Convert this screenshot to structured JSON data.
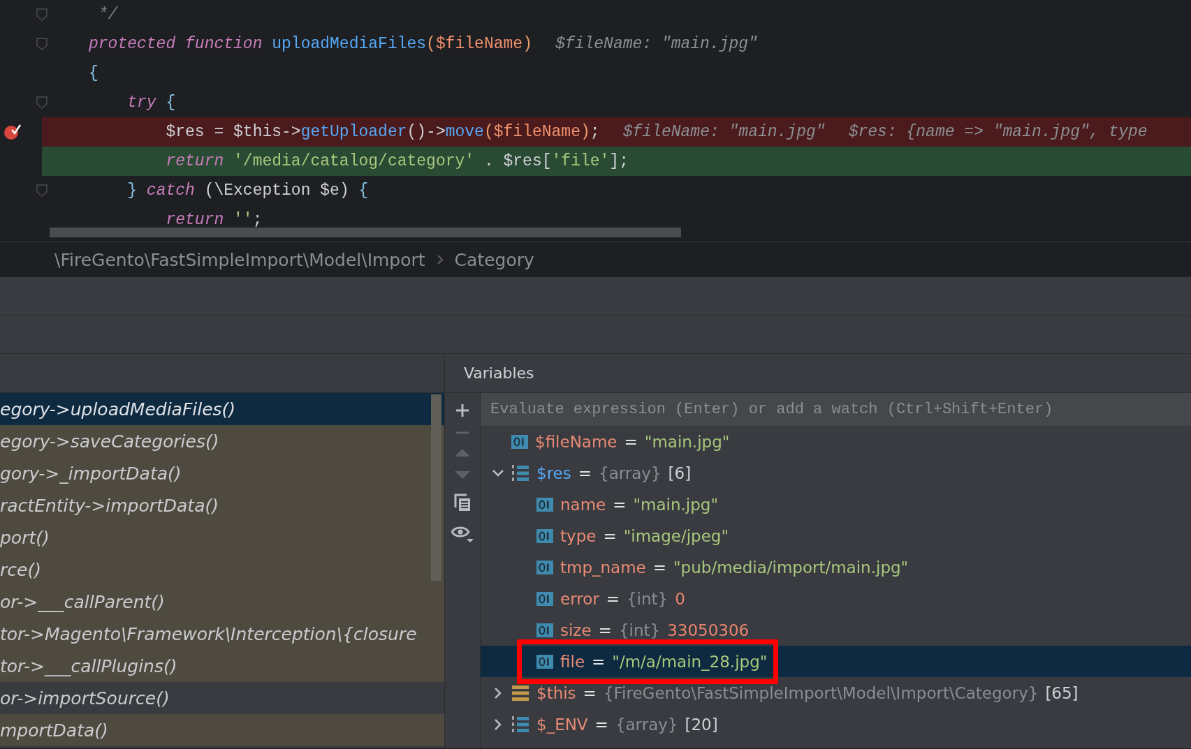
{
  "editor": {
    "lines": [
      {
        "fold": true,
        "breakpoint": false,
        "current": false,
        "tokens": [
          {
            "text": " */",
            "kind": "comment"
          }
        ]
      },
      {
        "fold": true,
        "breakpoint": false,
        "current": false,
        "tokens": [
          {
            "text": "protected function ",
            "kind": "keyword"
          },
          {
            "text": "uploadMediaFiles",
            "kind": "function"
          },
          {
            "text": "(",
            "kind": "paren"
          },
          {
            "text": "$fileName",
            "kind": "variable"
          },
          {
            "text": ")",
            "kind": "paren"
          },
          {
            "text": "$fileName: \"main.jpg\"",
            "kind": "hint"
          }
        ]
      },
      {
        "fold": false,
        "breakpoint": false,
        "current": false,
        "tokens": [
          {
            "text": "{",
            "kind": "brace"
          }
        ]
      },
      {
        "fold": true,
        "breakpoint": false,
        "current": false,
        "tokens": [
          {
            "text": "    try",
            "kind": "keyword"
          },
          {
            "text": " {",
            "kind": "brace"
          }
        ]
      },
      {
        "fold": false,
        "breakpoint": true,
        "current": false,
        "tokens": [
          {
            "text": "        $res = $this->",
            "kind": "plain"
          },
          {
            "text": "getUploader",
            "kind": "function"
          },
          {
            "text": "()->",
            "kind": "plain"
          },
          {
            "text": "move",
            "kind": "function"
          },
          {
            "text": "(",
            "kind": "paren"
          },
          {
            "text": "$fileName",
            "kind": "variable"
          },
          {
            "text": ")",
            "kind": "paren"
          },
          {
            "text": ";",
            "kind": "plain"
          },
          {
            "text": "$fileName: \"main.jpg\"",
            "kind": "hint"
          },
          {
            "text": "$res: {name => \"main.jpg\", type",
            "kind": "hint"
          }
        ]
      },
      {
        "fold": false,
        "breakpoint": false,
        "current": true,
        "tokens": [
          {
            "text": "        return ",
            "kind": "keyword"
          },
          {
            "text": "'/media/catalog/category'",
            "kind": "string"
          },
          {
            "text": " . $res[",
            "kind": "plain"
          },
          {
            "text": "'file'",
            "kind": "string"
          },
          {
            "text": "];",
            "kind": "plain"
          }
        ]
      },
      {
        "fold": true,
        "breakpoint": false,
        "current": false,
        "tokens": [
          {
            "text": "    } ",
            "kind": "brace"
          },
          {
            "text": "catch",
            "kind": "keyword"
          },
          {
            "text": " (\\Exception $e) ",
            "kind": "plain"
          },
          {
            "text": "{",
            "kind": "brace"
          }
        ]
      },
      {
        "fold": false,
        "breakpoint": false,
        "current": false,
        "tokens": [
          {
            "text": "        return ",
            "kind": "keyword"
          },
          {
            "text": "''",
            "kind": "string"
          },
          {
            "text": ";",
            "kind": "plain"
          }
        ]
      }
    ]
  },
  "breadcrumb": {
    "path": "\\FireGento\\FastSimpleImport\\Model\\Import",
    "current": "Category"
  },
  "frames": {
    "items": [
      {
        "text": "egory->uploadMediaFiles()",
        "selected": true,
        "library": true
      },
      {
        "text": "egory->saveCategories()",
        "selected": false,
        "library": true
      },
      {
        "text": "gory->_importData()",
        "selected": false,
        "library": true
      },
      {
        "text": "ractEntity->importData()",
        "selected": false,
        "library": true
      },
      {
        "text": "port()",
        "selected": false,
        "library": true
      },
      {
        "text": "rce()",
        "selected": false,
        "library": true
      },
      {
        "text": "or->___callParent()",
        "selected": false,
        "library": true
      },
      {
        "text": "tor->Magento\\Framework\\Interception\\{closure",
        "selected": false,
        "library": true
      },
      {
        "text": "tor->___callPlugins()",
        "selected": false,
        "library": true
      },
      {
        "text": "or->importSource()",
        "selected": false,
        "library": false
      },
      {
        "text": "mportData()",
        "selected": false,
        "library": true
      }
    ]
  },
  "variables": {
    "title": "Variables",
    "toolbar": [
      {
        "kind": "add",
        "disabled": false
      },
      {
        "kind": "remove",
        "disabled": true
      },
      {
        "kind": "up",
        "disabled": true
      },
      {
        "kind": "down",
        "disabled": true
      },
      {
        "kind": "copy",
        "disabled": false
      },
      {
        "kind": "watch",
        "disabled": false
      }
    ],
    "evaluate": {
      "placeholder": "Evaluate expression (Enter) or add a watch (Ctrl+Shift+Enter)"
    },
    "items": [
      {
        "kind": "scalar",
        "name": "$fileName",
        "changed": false,
        "operator": "=",
        "value": {
          "text": "\"main.jpg\"",
          "kind": "string"
        },
        "selected": false
      },
      {
        "kind": "array",
        "name": "$res",
        "changed": true,
        "operator": "=",
        "type": "{array}",
        "value": {
          "text": "[6]",
          "kind": "count"
        },
        "selected": false,
        "expanded": true,
        "children": [
          {
            "kind": "scalar",
            "name": "name",
            "changed": false,
            "operator": "=",
            "value": {
              "text": "\"main.jpg\"",
              "kind": "string"
            },
            "selected": false
          },
          {
            "kind": "scalar",
            "name": "type",
            "changed": false,
            "operator": "=",
            "value": {
              "text": "\"image/jpeg\"",
              "kind": "string"
            },
            "selected": false
          },
          {
            "kind": "scalar",
            "name": "tmp_name",
            "changed": false,
            "operator": "=",
            "value": {
              "text": "\"pub/media/import/main.jpg\"",
              "kind": "string"
            },
            "selected": false
          },
          {
            "kind": "scalar",
            "name": "error",
            "changed": false,
            "operator": "=",
            "type": "{int}",
            "value": {
              "text": "0",
              "kind": "number"
            },
            "selected": false
          },
          {
            "kind": "scalar",
            "name": "size",
            "changed": false,
            "operator": "=",
            "type": "{int}",
            "value": {
              "text": "33050306",
              "kind": "number"
            },
            "selected": false
          },
          {
            "kind": "scalar",
            "name": "file",
            "changed": false,
            "operator": "=",
            "value": {
              "text": "\"/m/a/main_28.jpg\"",
              "kind": "string"
            },
            "selected": true,
            "annotated": true
          }
        ]
      },
      {
        "kind": "object",
        "name": "$this",
        "changed": false,
        "operator": "=",
        "type": "{FireGento\\FastSimpleImport\\Model\\Import\\Category}",
        "value": {
          "text": "[65]",
          "kind": "count"
        },
        "selected": false,
        "expanded": false
      },
      {
        "kind": "array",
        "name": "$_ENV",
        "changed": false,
        "operator": "=",
        "type": "{array}",
        "value": {
          "text": "[20]",
          "kind": "count"
        },
        "selected": false,
        "expanded": false
      }
    ]
  }
}
